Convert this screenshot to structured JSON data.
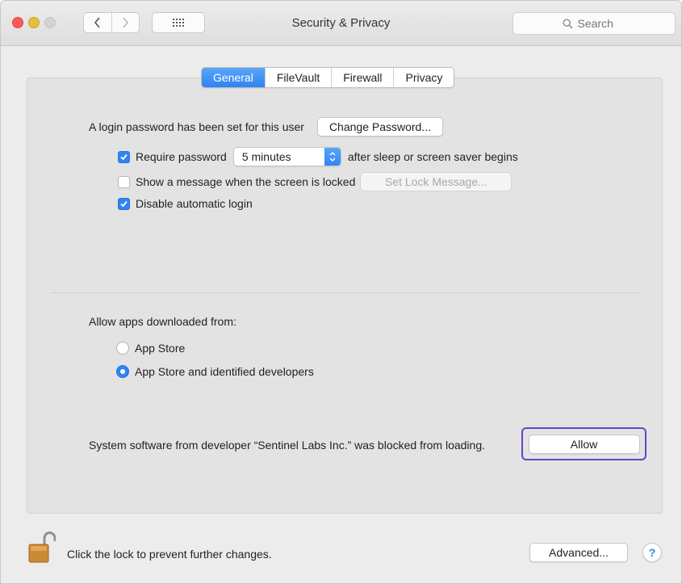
{
  "window": {
    "title": "Security & Privacy",
    "search_placeholder": "Search"
  },
  "tabs": [
    {
      "label": "General",
      "active": true
    },
    {
      "label": "FileVault",
      "active": false
    },
    {
      "label": "Firewall",
      "active": false
    },
    {
      "label": "Privacy",
      "active": false
    }
  ],
  "general": {
    "login_text": "A login password has been set for this user",
    "change_password_button": "Change Password...",
    "require_password": {
      "label": "Require password",
      "checked": true,
      "value": "5 minutes",
      "suffix": "after sleep or screen saver begins"
    },
    "show_message": {
      "label": "Show a message when the screen is locked",
      "checked": false,
      "button": "Set Lock Message...",
      "button_enabled": false
    },
    "disable_auto_login": {
      "label": "Disable automatic login",
      "checked": true
    },
    "allow_apps_label": "Allow apps downloaded from:",
    "allow_options": [
      {
        "label": "App Store",
        "selected": false
      },
      {
        "label": "App Store and identified developers",
        "selected": true
      }
    ],
    "blocked_message": "System software from developer “Sentinel Labs Inc.” was blocked from loading.",
    "allow_button": "Allow"
  },
  "footer": {
    "lock_message": "Click the lock to prevent further changes.",
    "advanced_button": "Advanced...",
    "help_button": "?"
  },
  "colors": {
    "accent": "#2f83f4",
    "highlight_border": "#6a43c7",
    "panel": "#e3e3e3"
  }
}
